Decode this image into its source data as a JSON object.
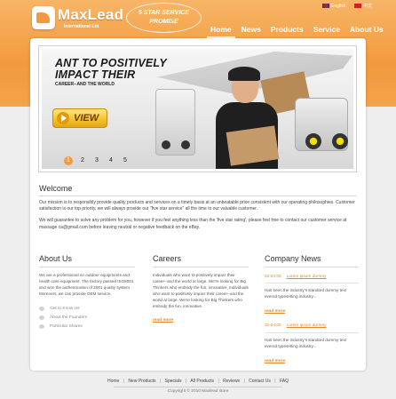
{
  "brand": {
    "name": "MaxLead",
    "subtitle": "International Ltd",
    "promise_line1": "5 STAR SERVICE",
    "promise_line2": "PROMISE"
  },
  "languages": [
    "English",
    "中文"
  ],
  "nav": [
    "Home",
    "News",
    "Products",
    "Service",
    "About Us"
  ],
  "banner": {
    "headline_line1": "ANT TO POSITIVELY",
    "headline_line2": "IMPACT THEIR",
    "subline": "CAREER--AND THE WORLD",
    "button_label": "VIEW",
    "pages": [
      "1",
      "2",
      "3",
      "4",
      "5"
    ]
  },
  "welcome": {
    "title": "Welcome",
    "para1": "Our mission is to responsibly provide quality products and services on a timely basis at an unbeatable price consistent with our operating philosophies. Customer satisfaction is our top priority, we will always provide our \"five star service\" all the time to our valuable customer.",
    "para2": "We will guarantee to solve any problem for you, however if you feel anything less than the 'five star rating', please feel free to contact our customer service at massage ca@gmail.com before leaving neutral or negative feedback on the eBay."
  },
  "about": {
    "title": "About Us",
    "text": "We are a professional on outdoor equipments and health care equipment. The factory passed ISO9001 and won the authentication of 2001 quality system. Moreover, we can provide OEM service.",
    "links": [
      "Get to Know Us",
      "About the Founders",
      "Particular Shares"
    ]
  },
  "careers": {
    "title": "Careers",
    "text": "Individuals who want to positively impact their career--and the world at large. We're looking for Big Thinkers who embody the fun, innovative, Individuals who want to positively impact their career--and the world at large. We're looking for Big Thinkers who embody the fun, innovative.",
    "readmore": "read more"
  },
  "news": {
    "title": "Company News",
    "items": [
      {
        "date": "22.04.09",
        "link": "Lorem ipsum dummy",
        "text": "Has been the industry's standard dummy text everod typesetting industry...",
        "readmore": "read more"
      },
      {
        "date": "22.04.09",
        "link": "Lorem ipsum dummy",
        "text": "Has been the industry's standard dummy text everod typesetting industry...",
        "readmore": "read more"
      }
    ]
  },
  "footer": {
    "links": [
      "Home",
      "New Products",
      "Specials",
      "All Products",
      "Reviews",
      "Contact Us",
      "FAQ"
    ],
    "separator": "|",
    "copyright": "Copyright © 2010 Maxlead store"
  },
  "colors": {
    "accent": "#f29a3d",
    "link": "#e08a2c",
    "background": "#eeeeee"
  }
}
